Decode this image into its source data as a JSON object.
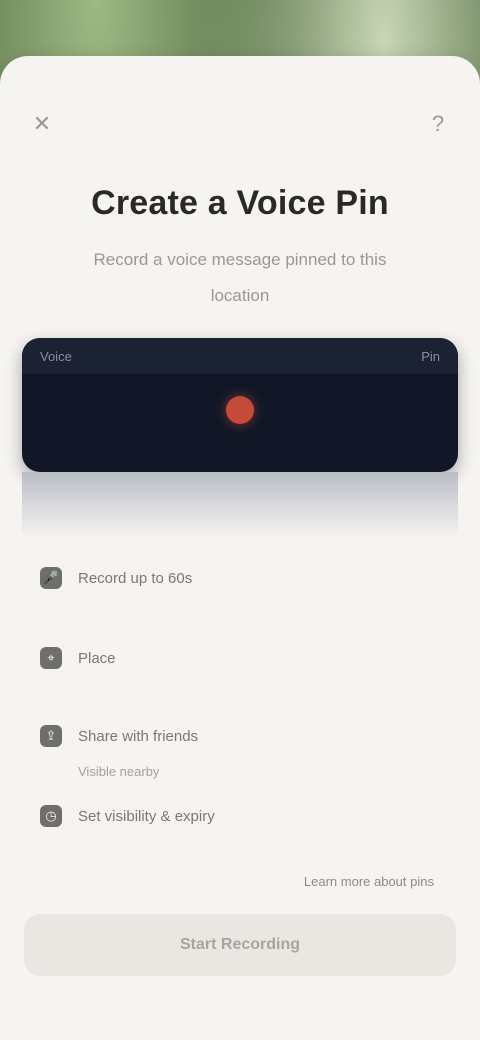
{
  "header": {
    "close_icon": "close-icon",
    "help_icon": "help-icon",
    "close_glyph": "✕",
    "help_glyph": "?"
  },
  "main": {
    "title": "Create a Voice Pin",
    "subtitle": "Record a voice message pinned to this location"
  },
  "hero": {
    "top_left": "Voice",
    "top_right": "Pin"
  },
  "features": [
    {
      "label": "Record up to 60s",
      "icon": "mic-icon",
      "glyph": "🎤"
    },
    {
      "label": "Place",
      "icon": "pin-icon",
      "glyph": "⌖"
    },
    {
      "label": "Share with friends",
      "icon": "share-icon",
      "glyph": "⇪",
      "sub": "Visible nearby"
    },
    {
      "label": "Set visibility & expiry",
      "icon": "clock-icon",
      "glyph": "◷"
    }
  ],
  "link": {
    "label": "Learn more about pins"
  },
  "cta": {
    "label": "Start Recording"
  }
}
